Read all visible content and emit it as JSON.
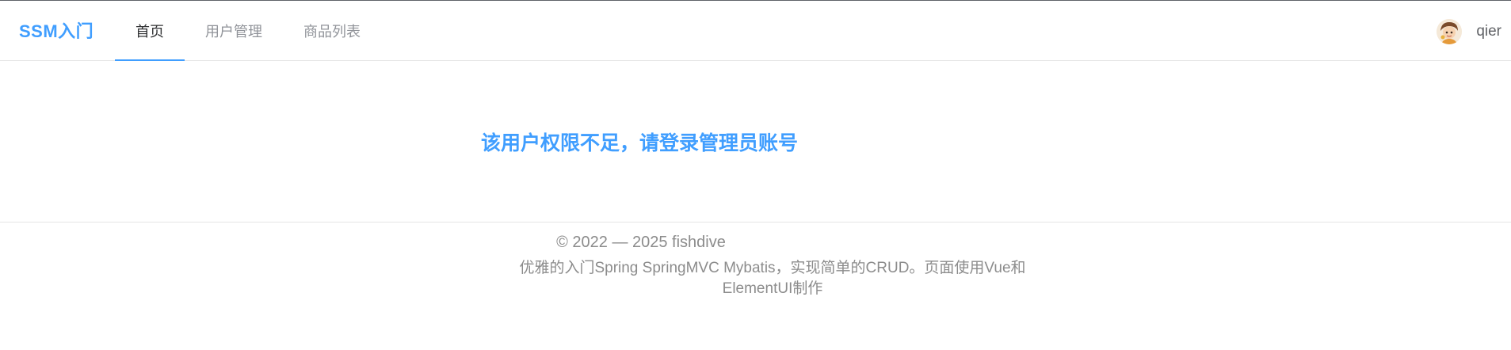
{
  "header": {
    "brand": "SSM入门",
    "nav": [
      {
        "label": "首页",
        "active": true
      },
      {
        "label": "用户管理",
        "active": false
      },
      {
        "label": "商品列表",
        "active": false
      }
    ],
    "user": {
      "name": "qier",
      "avatar_icon": "user-avatar-icon"
    }
  },
  "main": {
    "notice": "该用户权限不足，请登录管理员账号"
  },
  "footer": {
    "copyright": "© 2022 — 2025 fishdive",
    "description": "优雅的入门Spring SpringMVC Mybatis，实现简单的CRUD。页面使用Vue和ElementUI制作"
  },
  "colors": {
    "accent": "#409eff",
    "muted_text": "#8c8c8c",
    "divider": "#e6e6e6"
  }
}
